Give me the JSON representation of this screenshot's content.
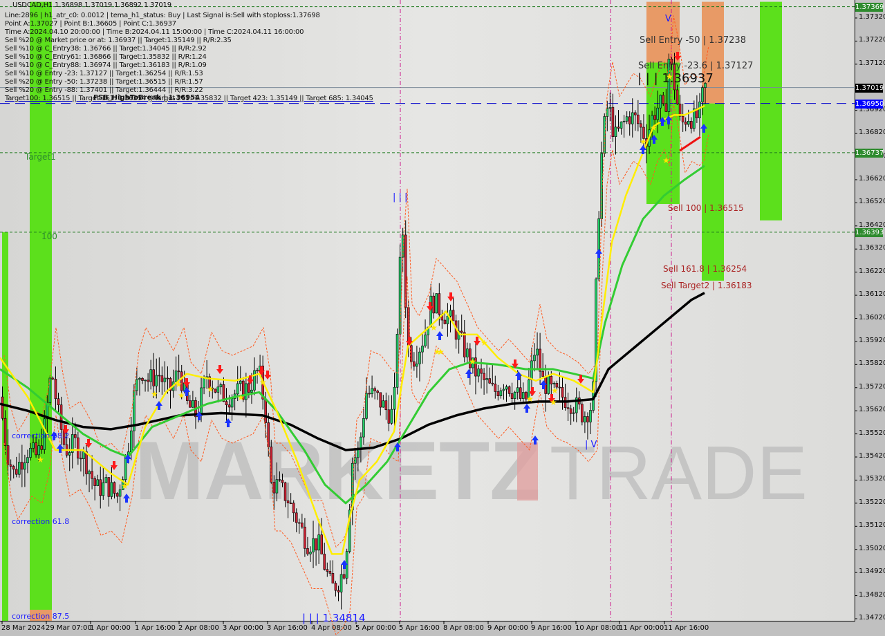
{
  "chart_data": {
    "type": "candlestick",
    "symbol": "USDCAD",
    "timeframe": "H1",
    "ohlc_header": "USDCAD,H1  1.36898 1.37019 1.36892 1.37019",
    "ylim": [
      1.3467,
      1.3739
    ],
    "y_ticks": [
      "1.37320",
      "1.37220",
      "1.37120",
      "1.36920",
      "1.36820",
      "1.36720",
      "1.36620",
      "1.36520",
      "1.36420",
      "1.36320",
      "1.36220",
      "1.36120",
      "1.36020",
      "1.35920",
      "1.35820",
      "1.35720",
      "1.35620",
      "1.35520",
      "1.35420",
      "1.35320",
      "1.35220",
      "1.35120",
      "1.35020",
      "1.34920",
      "1.34820",
      "1.34720"
    ],
    "x_ticks": [
      "28 Mar 2024",
      "29 Mar 07:00",
      "1 Apr 00:00",
      "1 Apr 16:00",
      "2 Apr 08:00",
      "3 Apr 00:00",
      "3 Apr 16:00",
      "4 Apr 08:00",
      "5 Apr 00:00",
      "5 Apr 16:00",
      "8 Apr 08:00",
      "9 Apr 00:00",
      "9 Apr 16:00",
      "10 Apr 08:00",
      "11 Apr 00:00",
      "11 Apr 16:00"
    ],
    "price_badges": [
      {
        "label": "1.37369",
        "value": 1.37369,
        "color": "#2e8b2e"
      },
      {
        "label": "1.37019",
        "value": 1.37019,
        "color": "#000000"
      },
      {
        "label": "1.36950",
        "value": 1.3695,
        "color": "#0000ff"
      },
      {
        "label": "1.36737",
        "value": 1.36737,
        "color": "#2e8b2e"
      },
      {
        "label": "1.36393",
        "value": 1.36393,
        "color": "#2e8b2e"
      }
    ],
    "horizontal_lines": [
      {
        "name": "top-target",
        "value": 1.37369,
        "style": "dashed",
        "color": "#1f7a1f"
      },
      {
        "name": "current-price",
        "value": 1.37019,
        "style": "solid",
        "color": "#7a8a99"
      },
      {
        "name": "bid-line",
        "value": 1.3695,
        "style": "dashed",
        "color": "#0000cc"
      },
      {
        "name": "target1",
        "value": 1.36737,
        "style": "dashed",
        "color": "#1f7a1f"
      },
      {
        "name": "level-100",
        "value": 1.36393,
        "style": "dashed",
        "color": "#1f7a1f"
      }
    ],
    "close_path": [
      [
        0,
        1.3568
      ],
      [
        10,
        1.3545
      ],
      [
        20,
        1.3535
      ],
      [
        30,
        1.354
      ],
      [
        40,
        1.3545
      ],
      [
        55,
        1.3542
      ],
      [
        65,
        1.3555
      ],
      [
        75,
        1.358
      ],
      [
        85,
        1.356
      ],
      [
        95,
        1.3545
      ],
      [
        110,
        1.3548
      ],
      [
        125,
        1.354
      ],
      [
        140,
        1.3528
      ],
      [
        155,
        1.353
      ],
      [
        170,
        1.3525
      ],
      [
        185,
        1.3545
      ],
      [
        195,
        1.357
      ],
      [
        205,
        1.358
      ],
      [
        215,
        1.3575
      ],
      [
        230,
        1.3578
      ],
      [
        245,
        1.357
      ],
      [
        260,
        1.358
      ],
      [
        270,
        1.3565
      ],
      [
        285,
        1.356
      ],
      [
        300,
        1.3578
      ],
      [
        315,
        1.357
      ],
      [
        330,
        1.3568
      ],
      [
        345,
        1.357
      ],
      [
        360,
        1.3572
      ],
      [
        375,
        1.358
      ],
      [
        385,
        1.356
      ],
      [
        392,
        1.353
      ],
      [
        400,
        1.353
      ],
      [
        415,
        1.3525
      ],
      [
        430,
        1.3515
      ],
      [
        445,
        1.3505
      ],
      [
        460,
        1.3505
      ],
      [
        470,
        1.3495
      ],
      [
        480,
        1.3485
      ],
      [
        490,
        1.3488
      ],
      [
        500,
        1.3495
      ],
      [
        510,
        1.354
      ],
      [
        520,
        1.3545
      ],
      [
        530,
        1.357
      ],
      [
        545,
        1.3568
      ],
      [
        560,
        1.3562
      ],
      [
        570,
        1.356
      ],
      [
        578,
        1.362
      ],
      [
        583,
        1.364
      ],
      [
        590,
        1.359
      ],
      [
        600,
        1.3585
      ],
      [
        615,
        1.3595
      ],
      [
        625,
        1.361
      ],
      [
        640,
        1.3605
      ],
      [
        655,
        1.36
      ],
      [
        670,
        1.359
      ],
      [
        685,
        1.358
      ],
      [
        700,
        1.3575
      ],
      [
        715,
        1.357
      ],
      [
        730,
        1.3575
      ],
      [
        745,
        1.357
      ],
      [
        760,
        1.3565
      ],
      [
        775,
        1.359
      ],
      [
        785,
        1.3575
      ],
      [
        800,
        1.357
      ],
      [
        815,
        1.3568
      ],
      [
        830,
        1.3565
      ],
      [
        845,
        1.356
      ],
      [
        858,
        1.3565
      ],
      [
        865,
        1.364
      ],
      [
        872,
        1.368
      ],
      [
        880,
        1.3695
      ],
      [
        890,
        1.368
      ],
      [
        900,
        1.3685
      ],
      [
        910,
        1.369
      ],
      [
        920,
        1.3688
      ],
      [
        935,
        1.368
      ],
      [
        945,
        1.369
      ],
      [
        955,
        1.3695
      ],
      [
        962,
        1.3688
      ],
      [
        968,
        1.3715
      ],
      [
        975,
        1.3705
      ],
      [
        985,
        1.3685
      ],
      [
        995,
        1.369
      ],
      [
        1005,
        1.3688
      ],
      [
        1012,
        1.369
      ],
      [
        1019,
        1.3702
      ]
    ],
    "ema_yellow": [
      [
        0,
        1.3585
      ],
      [
        40,
        1.3568
      ],
      [
        80,
        1.3545
      ],
      [
        120,
        1.3545
      ],
      [
        160,
        1.3535
      ],
      [
        185,
        1.353
      ],
      [
        210,
        1.3555
      ],
      [
        240,
        1.357
      ],
      [
        270,
        1.3578
      ],
      [
        300,
        1.3576
      ],
      [
        340,
        1.3575
      ],
      [
        375,
        1.3578
      ],
      [
        400,
        1.3562
      ],
      [
        430,
        1.354
      ],
      [
        460,
        1.3515
      ],
      [
        480,
        1.35
      ],
      [
        495,
        1.35
      ],
      [
        505,
        1.3515
      ],
      [
        520,
        1.3532
      ],
      [
        545,
        1.354
      ],
      [
        570,
        1.3553
      ],
      [
        590,
        1.359
      ],
      [
        620,
        1.3598
      ],
      [
        645,
        1.3605
      ],
      [
        665,
        1.3595
      ],
      [
        690,
        1.3595
      ],
      [
        720,
        1.3585
      ],
      [
        750,
        1.3578
      ],
      [
        775,
        1.3575
      ],
      [
        800,
        1.3578
      ],
      [
        830,
        1.3575
      ],
      [
        858,
        1.357
      ],
      [
        870,
        1.36
      ],
      [
        885,
        1.3635
      ],
      [
        905,
        1.3655
      ],
      [
        925,
        1.367
      ],
      [
        945,
        1.3685
      ],
      [
        960,
        1.3688
      ],
      [
        975,
        1.369
      ],
      [
        990,
        1.369
      ],
      [
        1005,
        1.3692
      ],
      [
        1019,
        1.3694
      ]
    ],
    "ema_green": [
      [
        0,
        1.358
      ],
      [
        40,
        1.3572
      ],
      [
        80,
        1.3562
      ],
      [
        120,
        1.3552
      ],
      [
        160,
        1.3545
      ],
      [
        185,
        1.3542
      ],
      [
        220,
        1.3555
      ],
      [
        260,
        1.356
      ],
      [
        300,
        1.3565
      ],
      [
        340,
        1.3568
      ],
      [
        375,
        1.357
      ],
      [
        400,
        1.3562
      ],
      [
        440,
        1.3545
      ],
      [
        470,
        1.353
      ],
      [
        500,
        1.3522
      ],
      [
        530,
        1.353
      ],
      [
        560,
        1.354
      ],
      [
        590,
        1.3555
      ],
      [
        620,
        1.357
      ],
      [
        650,
        1.358
      ],
      [
        680,
        1.3583
      ],
      [
        720,
        1.3582
      ],
      [
        760,
        1.358
      ],
      [
        800,
        1.358
      ],
      [
        830,
        1.3578
      ],
      [
        858,
        1.3576
      ],
      [
        875,
        1.36
      ],
      [
        900,
        1.3625
      ],
      [
        930,
        1.3645
      ],
      [
        960,
        1.3655
      ],
      [
        990,
        1.3662
      ],
      [
        1019,
        1.3668
      ]
    ],
    "ema_black": [
      [
        0,
        1.3565
      ],
      [
        40,
        1.3562
      ],
      [
        80,
        1.3558
      ],
      [
        120,
        1.3555
      ],
      [
        160,
        1.3554
      ],
      [
        200,
        1.3556
      ],
      [
        260,
        1.356
      ],
      [
        320,
        1.3561
      ],
      [
        380,
        1.356
      ],
      [
        420,
        1.3556
      ],
      [
        460,
        1.355
      ],
      [
        500,
        1.3545
      ],
      [
        540,
        1.3546
      ],
      [
        580,
        1.355
      ],
      [
        620,
        1.3556
      ],
      [
        660,
        1.356
      ],
      [
        700,
        1.3563
      ],
      [
        740,
        1.3565
      ],
      [
        780,
        1.3566
      ],
      [
        820,
        1.3566
      ],
      [
        858,
        1.3567
      ],
      [
        880,
        1.358
      ],
      [
        920,
        1.359
      ],
      [
        960,
        1.36
      ],
      [
        1000,
        1.361
      ],
      [
        1019,
        1.3613
      ]
    ],
    "annotations": [
      {
        "text": "Sell Entry -50 | 1.37238",
        "value": 1.37238
      },
      {
        "text": "Sell Entry -23.6 | 1.37127",
        "value": 1.37127
      },
      {
        "text": "| | | 1.36937",
        "value": 1.36937
      },
      {
        "text": "Sell 100 | 1.36515",
        "value": 1.36515
      },
      {
        "text": "Sell 161.8 | 1.36254",
        "value": 1.36254
      },
      {
        "text": "Sell Target2 | 1.36183",
        "value": 1.36183
      },
      {
        "text": "| | | 1.34814",
        "value": 1.34814
      },
      {
        "text": "Target1"
      },
      {
        "text": "100"
      },
      {
        "text": "correction 38.2"
      },
      {
        "text": "correction 61.8"
      },
      {
        "text": "correction 87.5"
      },
      {
        "text": "| | |"
      },
      {
        "text": "| V"
      },
      {
        "text": "V"
      }
    ],
    "zones": [
      {
        "name": "green-left-1",
        "color": "#5ce01c",
        "y_top": 1.36393,
        "y_bottom": 1.3467
      },
      {
        "name": "green-left-2",
        "color": "#5ce01c",
        "y_top": 1.3739,
        "y_bottom": 1.3467
      },
      {
        "name": "orange-zone-a",
        "color": "#e89a66",
        "y_top": 1.3739,
        "y_bottom": 1.37127
      },
      {
        "name": "green-zone-a",
        "color": "#5ce01c",
        "y_top": 1.37127,
        "y_bottom": 1.36515
      },
      {
        "name": "orange-zone-b",
        "color": "#e89a66",
        "y_top": 1.3739,
        "y_bottom": 1.3695
      },
      {
        "name": "green-zone-b",
        "color": "#5ce01c",
        "y_top": 1.3695,
        "y_bottom": 1.36183
      },
      {
        "name": "green-zone-c",
        "color": "#5ce01c",
        "y_top": 1.3739,
        "y_bottom": 1.36444
      }
    ],
    "vertical_lines": [
      "5 Apr 16:00",
      "10 Apr 20:00",
      "11 Apr 15:00"
    ]
  },
  "info_panel": {
    "title": "USDCAD,H1  1.36898 1.37019 1.36892 1.37019",
    "lines": [
      "Line:2896 | h1_atr_c0: 0.0012 | tema_h1_status: Buy | Last Signal is:Sell with stoploss:1.37698",
      "Point A:1.37027 | Point B:1.36605 | Point C:1.36937",
      "Time A:2024.04.10 20:00:00 | Time B:2024.04.11 15:00:00 | Time C:2024.04.11 16:00:00",
      "Sell %20 @ Market price or at: 1.36937 || Target:1.35149 || R/R:2.35",
      "Sell %10 @ C_Entry38: 1.36766 || Target:1.34045 || R/R:2.92",
      "Sell %10 @ C_Entry61: 1.36866 || Target:1.35832 || R/R:1.24",
      "Sell %10 @ C_Entry88: 1.36974 || Target:1.36183 || R/R:1.09",
      "Sell %10 @ Entry -23: 1.37127 || Target:1.36254 || R/R:1.53",
      "Sell %20 @ Entry -50: 1.37238 || Target:1.36515 || R/R:1.57",
      "Sell %20 @ Entry -88: 1.37401 || Target:1.36444 || R/R:3.22",
      "Target100: 1.36515 || Target 161: 1.36254 || Target 261: 1.35832 || Target 423: 1.35149 || Target 685: 1.34045"
    ],
    "overlap_label": "FSB_HighToBreak | 1.36954"
  },
  "watermark": {
    "left": "MARKETZ",
    "mid": "I",
    "right": "TRADE"
  }
}
